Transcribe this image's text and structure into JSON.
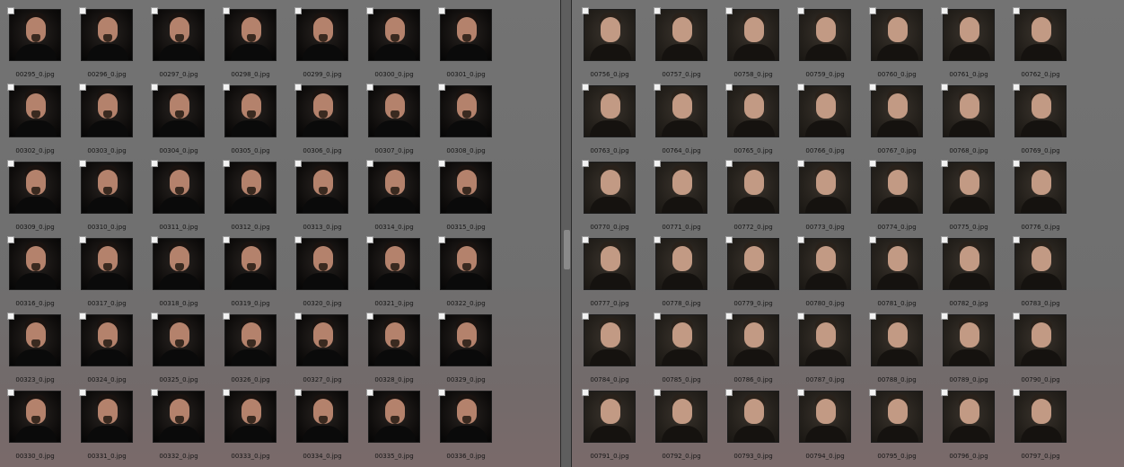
{
  "left_pane": {
    "files": [
      [
        "00295_0.jpg",
        "00296_0.jpg",
        "00297_0.jpg",
        "00298_0.jpg",
        "00299_0.jpg",
        "00300_0.jpg",
        "00301_0.jpg"
      ],
      [
        "00302_0.jpg",
        "00303_0.jpg",
        "00304_0.jpg",
        "00305_0.jpg",
        "00306_0.jpg",
        "00307_0.jpg",
        "00308_0.jpg"
      ],
      [
        "00309_0.jpg",
        "00310_0.jpg",
        "00311_0.jpg",
        "00312_0.jpg",
        "00313_0.jpg",
        "00314_0.jpg",
        "00315_0.jpg"
      ],
      [
        "00316_0.jpg",
        "00317_0.jpg",
        "00318_0.jpg",
        "00319_0.jpg",
        "00320_0.jpg",
        "00321_0.jpg",
        "00322_0.jpg"
      ],
      [
        "00323_0.jpg",
        "00324_0.jpg",
        "00325_0.jpg",
        "00326_0.jpg",
        "00327_0.jpg",
        "00328_0.jpg",
        "00329_0.jpg"
      ],
      [
        "00330_0.jpg",
        "00331_0.jpg",
        "00332_0.jpg",
        "00333_0.jpg",
        "00334_0.jpg",
        "00335_0.jpg",
        "00336_0.jpg"
      ]
    ]
  },
  "right_pane": {
    "files": [
      [
        "00756_0.jpg",
        "00757_0.jpg",
        "00758_0.jpg",
        "00759_0.jpg",
        "00760_0.jpg",
        "00761_0.jpg",
        "00762_0.jpg"
      ],
      [
        "00763_0.jpg",
        "00764_0.jpg",
        "00765_0.jpg",
        "00766_0.jpg",
        "00767_0.jpg",
        "00768_0.jpg",
        "00769_0.jpg"
      ],
      [
        "00770_0.jpg",
        "00771_0.jpg",
        "00772_0.jpg",
        "00773_0.jpg",
        "00774_0.jpg",
        "00775_0.jpg",
        "00776_0.jpg"
      ],
      [
        "00777_0.jpg",
        "00778_0.jpg",
        "00779_0.jpg",
        "00780_0.jpg",
        "00781_0.jpg",
        "00782_0.jpg",
        "00783_0.jpg"
      ],
      [
        "00784_0.jpg",
        "00785_0.jpg",
        "00786_0.jpg",
        "00787_0.jpg",
        "00788_0.jpg",
        "00789_0.jpg",
        "00790_0.jpg"
      ],
      [
        "00791_0.jpg",
        "00792_0.jpg",
        "00793_0.jpg",
        "00794_0.jpg",
        "00795_0.jpg",
        "00796_0.jpg",
        "00797_0.jpg"
      ]
    ]
  },
  "colors": {
    "pane_background": "#707070",
    "splitter": "#5e5e5e",
    "filename_text": "#161616"
  }
}
